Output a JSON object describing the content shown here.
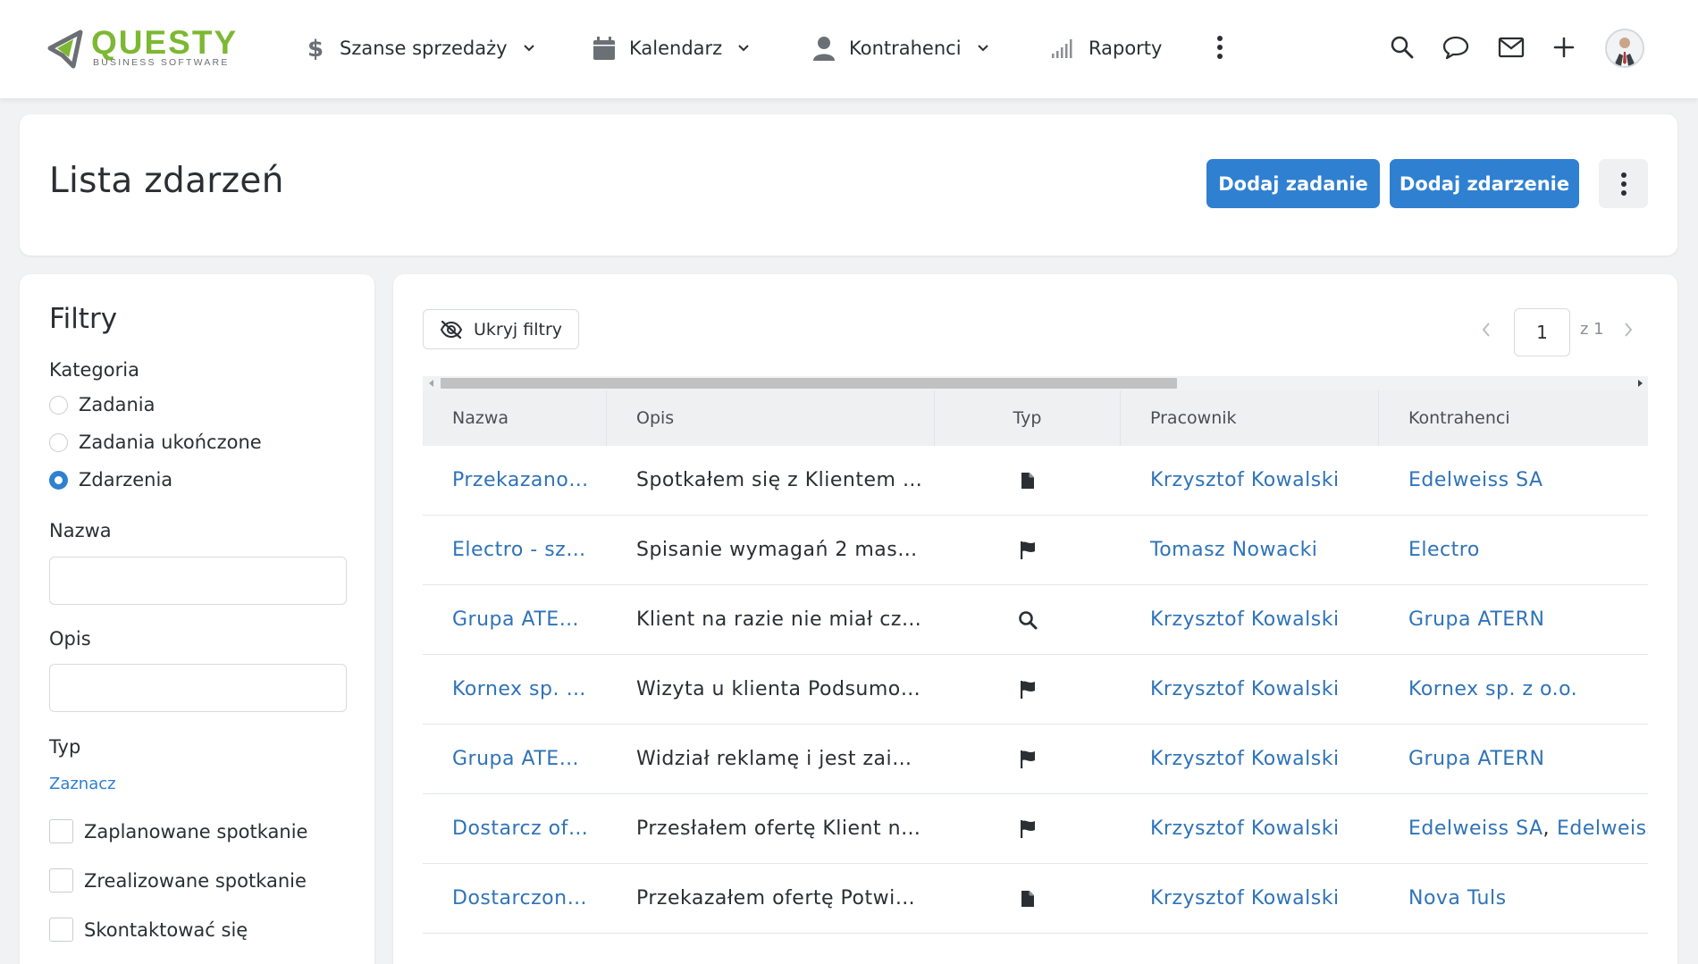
{
  "brand": {
    "name": "QUESTY",
    "tagline": "BUSINESS SOFTWARE",
    "accent": "#7cb832"
  },
  "nav": {
    "items": [
      {
        "label": "Szanse sprzedaży",
        "icon": "dollar-icon",
        "dropdown": true
      },
      {
        "label": "Kalendarz",
        "icon": "calendar-icon",
        "dropdown": true
      },
      {
        "label": "Kontrahenci",
        "icon": "person-icon",
        "dropdown": true
      },
      {
        "label": "Raporty",
        "icon": "signal-bars-icon",
        "dropdown": false
      }
    ],
    "right_icons": [
      "search-icon",
      "chat-bubble-icon",
      "mail-icon",
      "plus-icon"
    ]
  },
  "header": {
    "title": "Lista zdarzeń",
    "add_task_label": "Dodaj zadanie",
    "add_event_label": "Dodaj zdarzenie"
  },
  "filters": {
    "title": "Filtry",
    "category_label": "Kategoria",
    "categories": [
      {
        "label": "Zadania",
        "selected": false
      },
      {
        "label": "Zadania ukończone",
        "selected": false
      },
      {
        "label": "Zdarzenia",
        "selected": true
      }
    ],
    "name_label": "Nazwa",
    "name_value": "",
    "desc_label": "Opis",
    "desc_value": "",
    "type_label": "Typ",
    "select_link": "Zaznacz",
    "types": [
      {
        "label": "Zaplanowane spotkanie",
        "checked": false
      },
      {
        "label": "Zrealizowane spotkanie",
        "checked": false
      },
      {
        "label": "Skontaktować się",
        "checked": false
      }
    ]
  },
  "toolbar": {
    "hide_filters_label": "Ukryj filtry",
    "page_current": "1",
    "page_of": "z 1"
  },
  "table": {
    "columns": [
      "Nazwa",
      "Opis",
      "Typ",
      "Pracownik",
      "Kontrahenci"
    ],
    "rows": [
      {
        "name": "Przekazano…",
        "desc": "Spotkałem się z Klientem …",
        "type_icon": "document-icon",
        "employee": "Krzysztof Kowalski",
        "contractors": [
          "Edelweiss SA"
        ]
      },
      {
        "name": "Electro - sz…",
        "desc": "Spisanie wymagań 2 mas…",
        "type_icon": "flag-icon",
        "employee": "Tomasz Nowacki",
        "contractors": [
          "Electro"
        ]
      },
      {
        "name": "Grupa ATE…",
        "desc": "Klient na razie nie miał cz…",
        "type_icon": "search-icon",
        "employee": "Krzysztof Kowalski",
        "contractors": [
          "Grupa ATERN"
        ]
      },
      {
        "name": "Kornex sp. …",
        "desc": "Wizyta u klienta Podsumo…",
        "type_icon": "flag-icon",
        "employee": "Krzysztof Kowalski",
        "contractors": [
          "Kornex sp. z o.o."
        ]
      },
      {
        "name": "Grupa ATE…",
        "desc": "Widział reklamę i jest zai…",
        "type_icon": "flag-icon",
        "employee": "Krzysztof Kowalski",
        "contractors": [
          "Grupa ATERN"
        ]
      },
      {
        "name": "Dostarcz of…",
        "desc": "Przesłałem ofertę Klient n…",
        "type_icon": "flag-icon",
        "employee": "Krzysztof Kowalski",
        "contractors": [
          "Edelweiss SA",
          "Edelweiss"
        ]
      },
      {
        "name": "Dostarczon…",
        "desc": "Przekazałem ofertę Potwi…",
        "type_icon": "document-icon",
        "employee": "Krzysztof Kowalski",
        "contractors": [
          "Nova Tuls"
        ]
      }
    ]
  },
  "colors": {
    "primary": "#2f80d1",
    "link": "#2f73b8"
  }
}
